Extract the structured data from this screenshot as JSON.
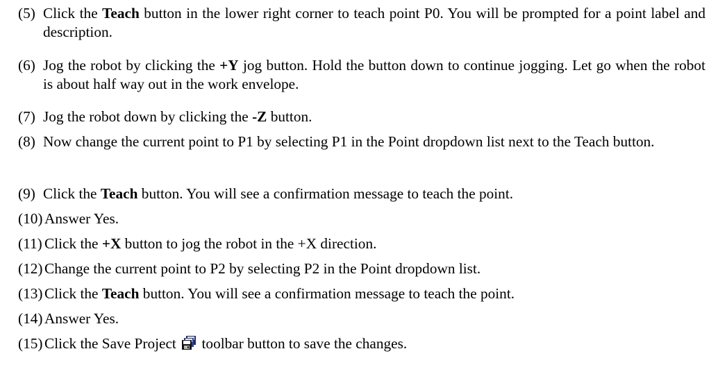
{
  "steps": [
    {
      "num": "(5)",
      "parts": [
        {
          "t": "Click the "
        },
        {
          "b": "Teach"
        },
        {
          "t": " button in the lower right corner to teach point P0.  You will be prompted for a point label and description."
        }
      ]
    },
    {
      "num": "(6)",
      "parts": [
        {
          "t": "Jog the robot by clicking the "
        },
        {
          "b": "+Y"
        },
        {
          "t": " jog button.  Hold the button down to continue jogging.  Let go when the robot is about half way out in the work envelope."
        }
      ]
    },
    {
      "num": "(7)",
      "parts": [
        {
          "t": "Jog the robot down by clicking the "
        },
        {
          "b": "-Z"
        },
        {
          "t": " button."
        }
      ]
    },
    {
      "num": "(8)",
      "parts": [
        {
          "t": "Now change the current point to P1 by selecting P1 in the Point dropdown list next to the Teach button."
        }
      ]
    },
    {
      "num": "(9)",
      "parts": [
        {
          "t": "Click the "
        },
        {
          "b": "Teach"
        },
        {
          "t": " button.  You will see a confirmation message to teach the point."
        }
      ]
    },
    {
      "num": "(10)",
      "parts": [
        {
          "t": "Answer Yes."
        }
      ]
    },
    {
      "num": "(11)",
      "parts": [
        {
          "t": "Click the "
        },
        {
          "b": "+X"
        },
        {
          "t": " button to jog the robot in the +X direction."
        }
      ]
    },
    {
      "num": "(12)",
      "parts": [
        {
          "t": "Change the current point to P2 by selecting P2 in the Point dropdown list."
        }
      ]
    },
    {
      "num": "(13)",
      "parts": [
        {
          "t": "Click the "
        },
        {
          "b": "Teach"
        },
        {
          "t": " button. You will see a confirmation message to teach the point."
        }
      ]
    },
    {
      "num": "(14)",
      "parts": [
        {
          "t": "Answer Yes."
        }
      ]
    },
    {
      "num": "(15)",
      "parts": [
        {
          "t": "Click the Save Project "
        },
        {
          "icon": "save-project-icon"
        },
        {
          "t": " toolbar button to save the changes."
        }
      ]
    }
  ]
}
